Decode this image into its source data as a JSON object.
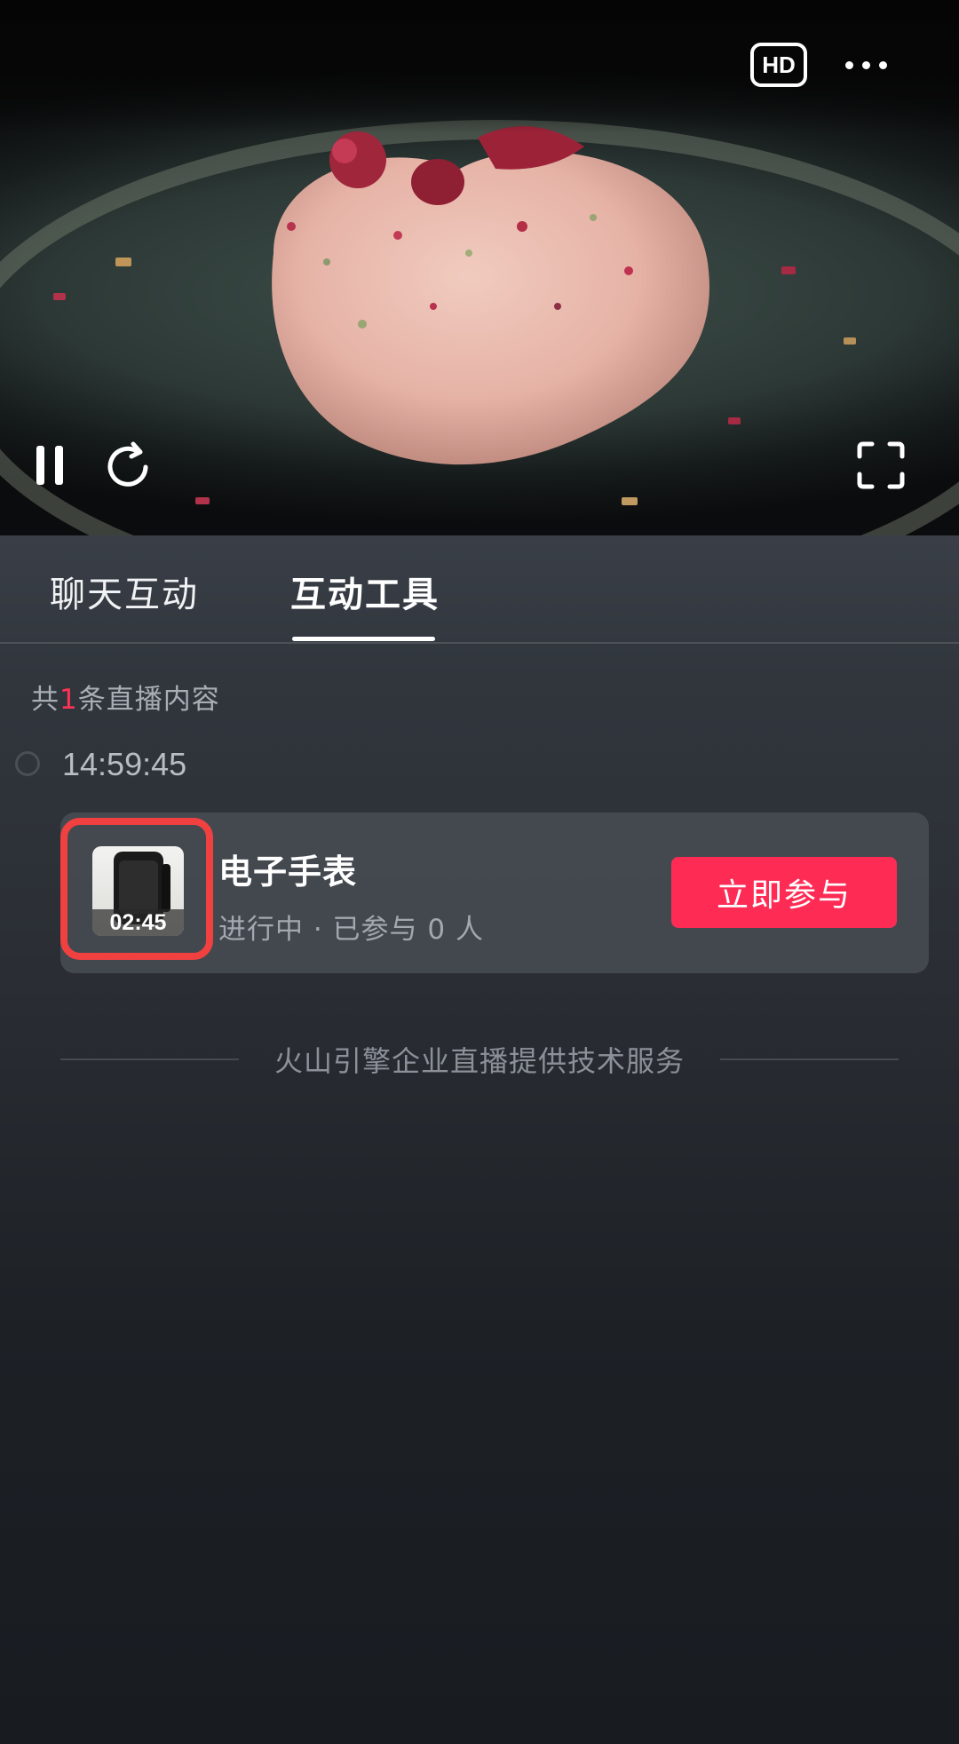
{
  "video": {
    "hd_label": "HD",
    "controls": {
      "pause_icon": "pause-icon",
      "refresh_icon": "refresh-icon",
      "fullscreen_icon": "fullscreen-icon",
      "more_icon": "more-dots-icon"
    }
  },
  "tabs": [
    {
      "label": "聊天互动",
      "active": false
    },
    {
      "label": "互动工具",
      "active": true
    }
  ],
  "content": {
    "count_prefix": "共",
    "count_value": "1",
    "count_suffix": "条直播内容",
    "timestamp": "14:59:45"
  },
  "item": {
    "thumbnail_timer": "02:45",
    "title": "电子手表",
    "status": "进行中 · 已参与 0 人",
    "join_label": "立即参与"
  },
  "footer": {
    "text": "火山引擎企业直播提供技术服务"
  },
  "colors": {
    "accent": "#fe2c55",
    "highlight_frame": "#f04040",
    "background": "#2a2e34"
  }
}
